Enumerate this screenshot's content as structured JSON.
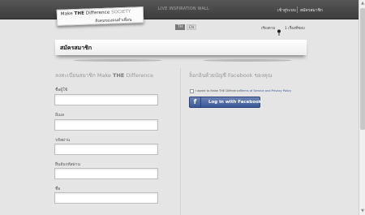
{
  "header": {
    "logo": {
      "line1_prefix": "Make ",
      "line1_bold": "THE",
      "line1_mid": " Difference ",
      "line1_suffix": "SOCIETY",
      "line2": "สังคมของคนทำเพื่อน"
    },
    "nav_wall": "LIVE INSPIRATION WALL",
    "login": "เข้าสู่ระบบ",
    "register": "สมัครสมาชิก"
  },
  "lang": {
    "th": "TH",
    "en": "EN"
  },
  "sort": {
    "label": "เรียงตาม",
    "favorites_text": "1 เรื่องที่ชอบ",
    "icon": "pin-icon"
  },
  "banner": {
    "title": "สมัครสมาชิก"
  },
  "left_column": {
    "title_prefix": "ลงทะเบียนสมาชิก Make ",
    "title_bold": "THE",
    "title_suffix": " Difference",
    "fields": [
      {
        "label": "ชื่อผู้ใช้",
        "value": ""
      },
      {
        "label": "อีเมล",
        "value": ""
      },
      {
        "label": "รหัสผ่าน",
        "value": ""
      },
      {
        "label": "ยืนยันรหัสผ่าน",
        "value": ""
      },
      {
        "label": "ชื่อ",
        "value": ""
      }
    ]
  },
  "right_column": {
    "title": "ล็อกอินด้วยบัญชี Facebook ของคุณ",
    "terms_text": "I agree to Make THE Difference",
    "terms_link": "Terms of Service and Privacy Policy",
    "fb_button": "Log in with Facebook",
    "fb_icon": "f",
    "fb_color": "#3b5998"
  },
  "scrollbar": {
    "up": "▲",
    "down": "▼"
  }
}
